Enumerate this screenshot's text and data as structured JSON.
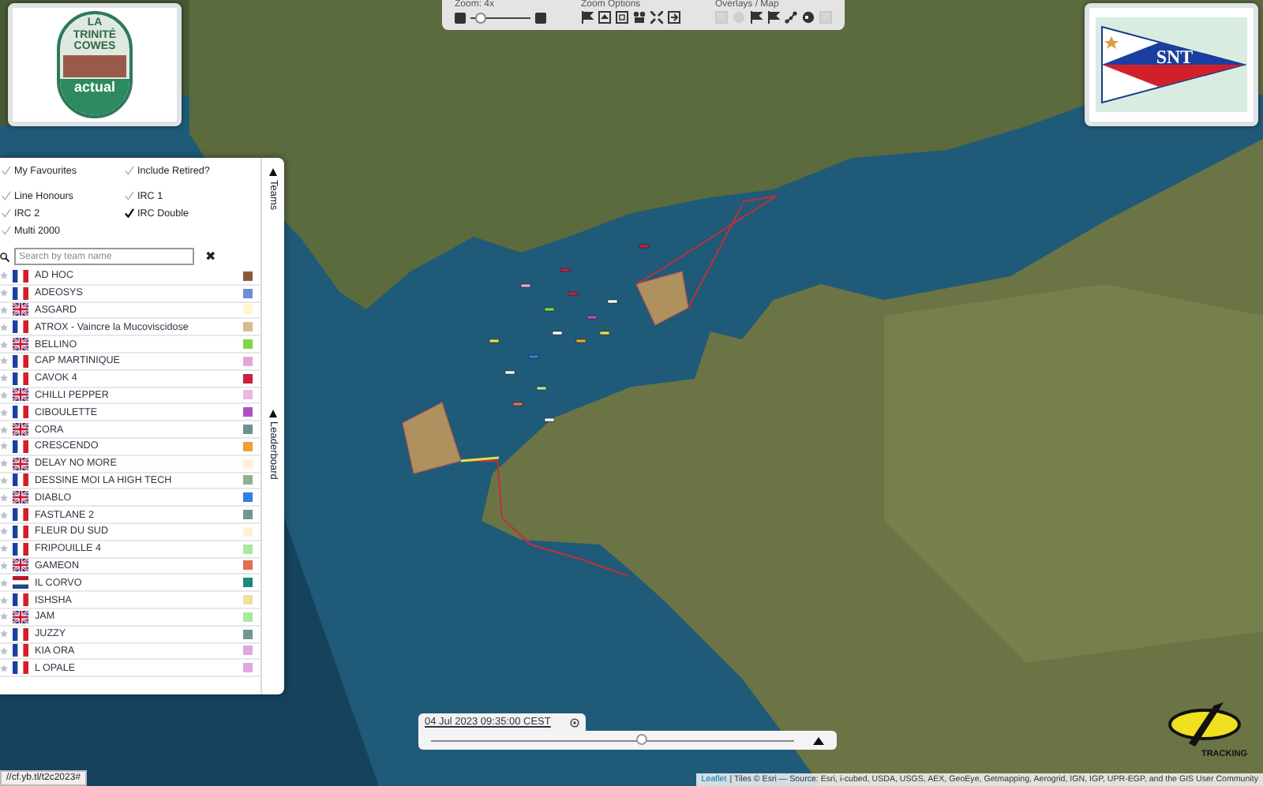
{
  "logos": {
    "left": {
      "lines": [
        "LA",
        "TRINITÉ",
        "COWES"
      ],
      "sponsor": "actual"
    },
    "right": {
      "text": "SNT"
    }
  },
  "toolbar": {
    "zoom": {
      "label": "Zoom: 4x",
      "level": 0.15
    },
    "options_label": "Zoom Options",
    "overlays_label": "Overlays / Map"
  },
  "filters": [
    {
      "label": "My Favourites",
      "checked": false
    },
    {
      "label": "Include Retired?",
      "checked": false
    },
    {
      "label": "Line Honours",
      "checked": false
    },
    {
      "label": "IRC 1",
      "checked": false
    },
    {
      "label": "IRC 2",
      "checked": false
    },
    {
      "label": "IRC Double",
      "checked": true
    },
    {
      "label": "Multi 2000",
      "checked": false
    }
  ],
  "search": {
    "placeholder": "Search by team name",
    "clear": "✖"
  },
  "teams": [
    {
      "name": "AD HOC",
      "kind": "fr",
      "color": "#8b5a3c"
    },
    {
      "name": "ADEOSYS",
      "kind": "fr",
      "color": "#6d8fd8"
    },
    {
      "name": "ASGARD",
      "kind": "gb",
      "color": "#fff6d0"
    },
    {
      "name": "ATROX - Vaincre la Mucoviscidose",
      "kind": "fr",
      "color": "#d8b890"
    },
    {
      "name": "BELLINO",
      "kind": "gb",
      "color": "#80d840"
    },
    {
      "name": "CAP MARTINIQUE",
      "kind": "fr",
      "color": "#e0a8d8"
    },
    {
      "name": "CAVOK 4",
      "kind": "fr",
      "color": "#c82040"
    },
    {
      "name": "CHILLI PEPPER",
      "kind": "gb",
      "color": "#e8b8e0"
    },
    {
      "name": "CIBOULETTE",
      "kind": "fr",
      "color": "#b050c0"
    },
    {
      "name": "CORA",
      "kind": "gb",
      "color": "#709090"
    },
    {
      "name": "CRESCENDO",
      "kind": "fr",
      "color": "#f0a030"
    },
    {
      "name": "DELAY NO MORE",
      "kind": "gb",
      "color": "#fff0d8"
    },
    {
      "name": "DESSINE MOI LA HIGH TECH",
      "kind": "fr",
      "color": "#90b090"
    },
    {
      "name": "DIABLO",
      "kind": "gb",
      "color": "#3080e0"
    },
    {
      "name": "FASTLANE 2",
      "kind": "fr",
      "color": "#709890"
    },
    {
      "name": "FLEUR DU SUD",
      "kind": "fr",
      "color": "#fff0d8"
    },
    {
      "name": "FRIPOUILLE 4",
      "kind": "fr",
      "color": "#a8e8a0"
    },
    {
      "name": "GAMEON",
      "kind": "gb",
      "color": "#e07050"
    },
    {
      "name": "IL CORVO",
      "kind": "nl",
      "color": "#208878"
    },
    {
      "name": "ISHSHA",
      "kind": "fr",
      "color": "#f0e0a0"
    },
    {
      "name": "JAM",
      "kind": "gb",
      "color": "#a8e8a0"
    },
    {
      "name": "JUZZY",
      "kind": "fr",
      "color": "#709890"
    },
    {
      "name": "KIA ORA",
      "kind": "fr",
      "color": "#e0a8e0"
    },
    {
      "name": "L OPALE",
      "kind": "fr",
      "color": "#e0a8e0"
    }
  ],
  "side_tabs": [
    "Teams",
    "Leaderboard"
  ],
  "timeline": {
    "date": "04 Jul 2023 09:35:00 CEST",
    "level": 0.58
  },
  "tracking_logo": {
    "text": "TRACKING"
  },
  "attribution": {
    "link": "Leaflet",
    "text": "| Tiles © Esri — Source: Esri, i-cubed, USDA, USGS, AEX, GeoEye, Getmapping, Aerogrid, IGN, IGP, UPR-EGP, and the GIS User Community"
  },
  "status_url": "//cf.yb.tl/t2c2023#"
}
